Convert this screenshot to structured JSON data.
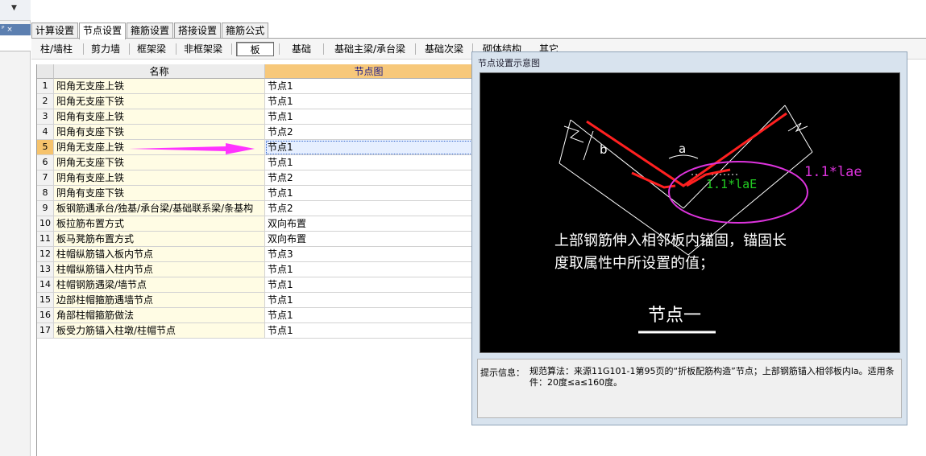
{
  "left": {
    "pin_label": "ᴾ ×"
  },
  "tabs": [
    {
      "label": "计算设置"
    },
    {
      "label": "节点设置"
    },
    {
      "label": "箍筋设置"
    },
    {
      "label": "搭接设置"
    },
    {
      "label": "箍筋公式"
    }
  ],
  "subtabs": [
    {
      "label": "柱/墙柱"
    },
    {
      "label": "剪力墙"
    },
    {
      "label": "框架梁"
    },
    {
      "label": "非框架梁"
    },
    {
      "label": "板"
    },
    {
      "label": "基础"
    },
    {
      "label": "基础主梁/承台梁"
    },
    {
      "label": "基础次梁"
    },
    {
      "label": "砌体结构"
    },
    {
      "label": "其它"
    }
  ],
  "grid": {
    "headers": {
      "name": "名称",
      "node": "节点图"
    },
    "rows": [
      {
        "num": "1",
        "name": "阳角无支座上铁",
        "node": "节点1"
      },
      {
        "num": "2",
        "name": "阳角无支座下铁",
        "node": "节点1"
      },
      {
        "num": "3",
        "name": "阳角有支座上铁",
        "node": "节点1"
      },
      {
        "num": "4",
        "name": "阳角有支座下铁",
        "node": "节点2"
      },
      {
        "num": "5",
        "name": "阴角无支座上铁",
        "node": "节点1"
      },
      {
        "num": "6",
        "name": "阴角无支座下铁",
        "node": "节点1"
      },
      {
        "num": "7",
        "name": "阴角有支座上铁",
        "node": "节点2"
      },
      {
        "num": "8",
        "name": "阴角有支座下铁",
        "node": "节点1"
      },
      {
        "num": "9",
        "name": "板钢筋遇承台/独基/承台梁/基础联系梁/条基构",
        "node": "节点2"
      },
      {
        "num": "10",
        "name": "板拉筋布置方式",
        "node": "双向布置"
      },
      {
        "num": "11",
        "name": "板马凳筋布置方式",
        "node": "双向布置"
      },
      {
        "num": "12",
        "name": "柱帽纵筋锚入板内节点",
        "node": "节点3"
      },
      {
        "num": "13",
        "name": "柱帽纵筋锚入柱内节点",
        "node": "节点1"
      },
      {
        "num": "14",
        "name": "柱帽钢筋遇梁/墙节点",
        "node": "节点1"
      },
      {
        "num": "15",
        "name": "边部柱帽箍筋遇墙节点",
        "node": "节点1"
      },
      {
        "num": "16",
        "name": "角部柱帽箍筋做法",
        "node": "节点1"
      },
      {
        "num": "17",
        "name": "板受力筋锚入柱墩/柱帽节点",
        "node": "节点1"
      }
    ]
  },
  "panel": {
    "title": "节点设置示意图",
    "diagram": {
      "label_a": "a",
      "label_b": "b",
      "green_label": "1.1*laE",
      "magenta_label": "1.1*lae",
      "desc_line1": "上部钢筋伸入相邻板内锚固，锚固长",
      "desc_line2": "度取属性中所设置的值；",
      "node_title": "节点一"
    },
    "hint_label": "提示信息：",
    "hint_text": "规范算法：来源11G101-1第95页的“折板配筋构造”节点；上部钢筋锚入相邻板内la。适用条件：20度≤a≤160度。"
  },
  "colors": {
    "accent_header": "#f7c87a",
    "name_cell_bg": "#fffce4",
    "arrow": "#ff33ff",
    "rebar": "#ff2020",
    "anchor_text": "#22cc22",
    "ellipse": "#dd33dd"
  }
}
